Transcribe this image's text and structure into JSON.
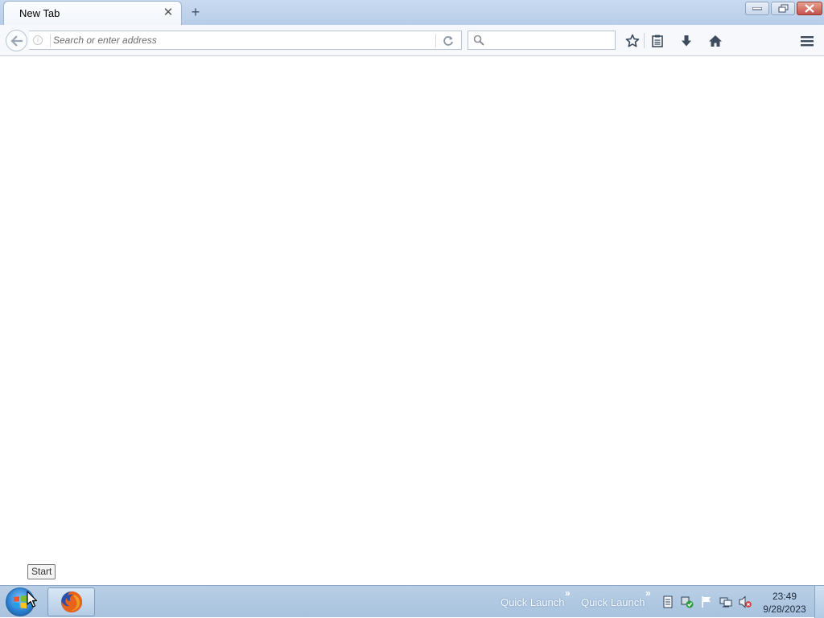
{
  "browser": {
    "tab": {
      "title": "New Tab",
      "close_glyph": "✕"
    },
    "newtab_glyph": "+",
    "urlbar": {
      "placeholder": "Search or enter address",
      "value": ""
    },
    "searchbar": {
      "placeholder": "",
      "value": ""
    },
    "toolbar_icons": [
      "bookmark-star-icon",
      "reading-list-icon",
      "downloads-icon",
      "home-icon",
      "menu-icon"
    ]
  },
  "tooltip": {
    "text": "Start"
  },
  "taskbar": {
    "quick_launch_1": "Quick Launch",
    "quick_launch_2": "Quick Launch",
    "chevron": "»",
    "clock": {
      "time": "23:49",
      "date": "9/28/2023"
    }
  },
  "colors": {
    "tabstrip": "#c9daf0",
    "taskbar": "#b9cfe6",
    "close_button": "#c75050"
  }
}
